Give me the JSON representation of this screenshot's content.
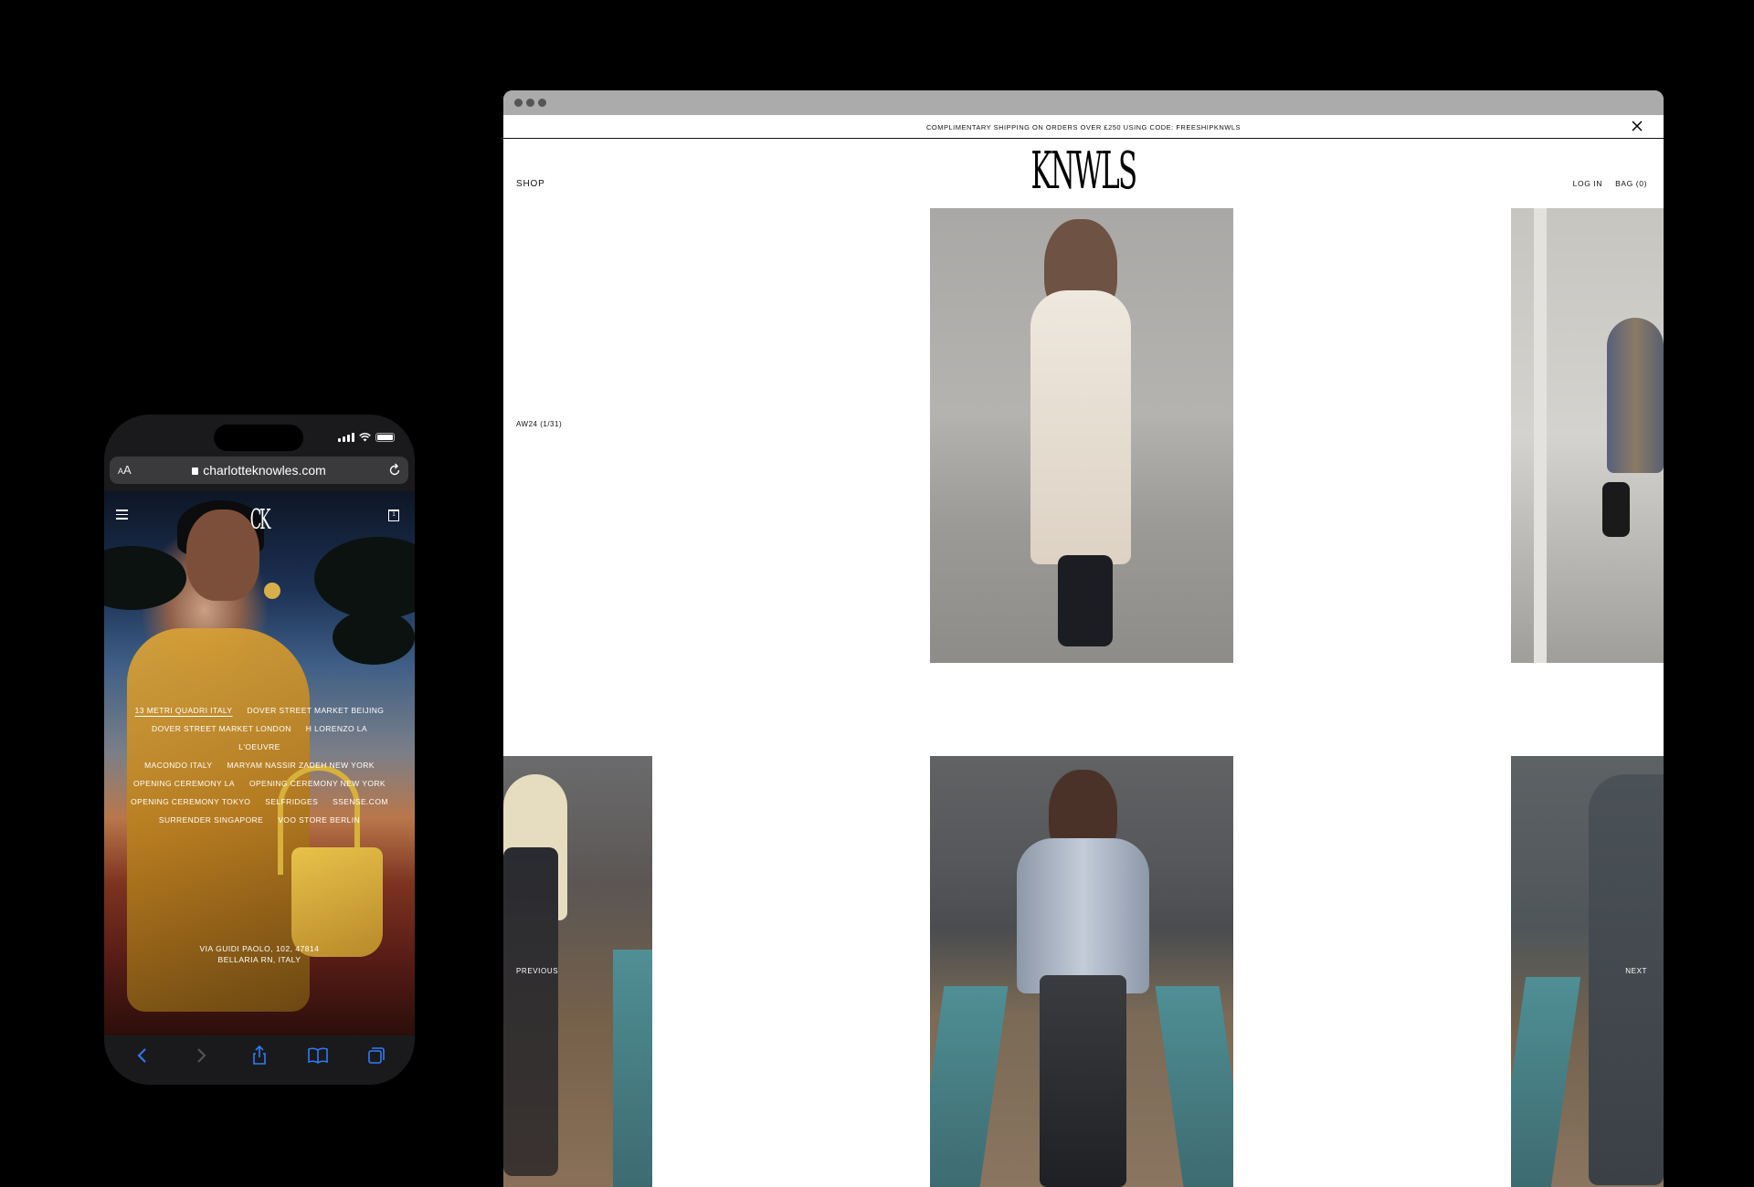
{
  "phone": {
    "url_aa": "AA",
    "url": "charlotteknowles.com",
    "logo": "CK",
    "bag_count": "1",
    "stores": [
      {
        "label": "13 METRI QUADRI ITALY",
        "active": true
      },
      {
        "label": "DOVER STREET MARKET BEIJING"
      },
      {
        "label": "DOVER STREET MARKET LONDON"
      },
      {
        "label": "H LORENZO LA"
      },
      {
        "label": "L'OEUVRE"
      },
      {
        "label": "MACONDO ITALY"
      },
      {
        "label": "MARYAM NASSIR ZADEH NEW YORK"
      },
      {
        "label": "OPENING CEREMONY LA"
      },
      {
        "label": "OPENING CEREMONY NEW YORK"
      },
      {
        "label": "OPENING CEREMONY TOKYO"
      },
      {
        "label": "SELFRIDGES"
      },
      {
        "label": "SSENSE.COM"
      },
      {
        "label": "SURRENDER SINGAPORE"
      },
      {
        "label": "VOO STORE BERLIN"
      }
    ],
    "address_line1": "VIA GUIDI PAOLO, 102, 47814",
    "address_line2": "BELLARIA RN, ITALY",
    "toolbar": [
      "back-icon",
      "forward-icon",
      "share-icon",
      "bookmarks-icon",
      "tabs-icon"
    ]
  },
  "browser": {
    "promo": "COMPLIMENTARY SHIPPING ON ORDERS OVER £250 USING CODE: FREESHIPKNWLS",
    "shop": "SHOP",
    "logo": "KNWLS",
    "login": "LOG IN",
    "bag": "BAG (0)",
    "collection": "AW24 (1/31)",
    "previous": "PREVIOUS",
    "next": "NEXT"
  },
  "colors": {
    "background": "#000000",
    "accent_ios": "#2f7cf6",
    "chrome_bar": "#ababab"
  }
}
